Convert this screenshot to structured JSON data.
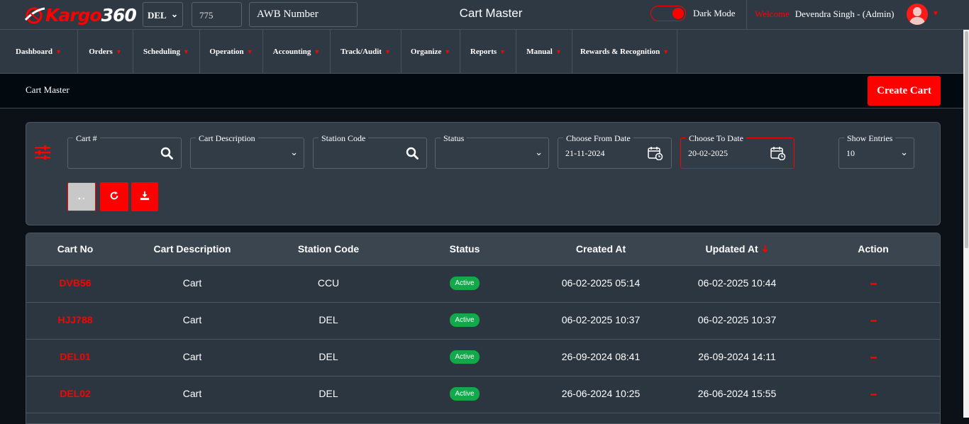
{
  "header": {
    "logo_text_brand": "Kargo",
    "logo_text_num": "360",
    "station": "DEL",
    "code": "775",
    "awb_placeholder": "AWB Number",
    "page_title": "Cart Master",
    "dark_mode_label": "Dark Mode",
    "dark_mode_on": true,
    "welcome": "Welcome",
    "user": "Devendra Singh - (Admin)"
  },
  "nav": {
    "items": [
      {
        "label": "Dashboard"
      },
      {
        "label": "Orders"
      },
      {
        "label": "Scheduling"
      },
      {
        "label": "Operation"
      },
      {
        "label": "Accounting"
      },
      {
        "label": "Track/Audit"
      },
      {
        "label": "Organize"
      },
      {
        "label": "Reports"
      },
      {
        "label": "Manual"
      },
      {
        "label": "Rewards & Recognition"
      }
    ]
  },
  "breadcrumb": "Cart Master",
  "create_button": "Create Cart",
  "filters": {
    "cart_no": {
      "label": "Cart #",
      "value": ""
    },
    "cart_description": {
      "label": "Cart Description",
      "value": ""
    },
    "station_code": {
      "label": "Station Code",
      "value": ""
    },
    "status": {
      "label": "Status",
      "value": ""
    },
    "from_date": {
      "label": "Choose From Date",
      "value": "21-11-2024"
    },
    "to_date": {
      "label": "Choose To Date",
      "value": "20-02-2025"
    },
    "show_entries": {
      "label": "Show Entries",
      "value": "10"
    }
  },
  "table": {
    "columns": [
      "Cart No",
      "Cart Description",
      "Station Code",
      "Status",
      "Created At",
      "Updated At",
      "Action"
    ],
    "rows": [
      {
        "cart_no": "DVB56",
        "description": "Cart",
        "station": "CCU",
        "status": "Active",
        "created": "06-02-2025 05:14",
        "updated": "06-02-2025 10:44",
        "action": "•••"
      },
      {
        "cart_no": "HJJ788",
        "description": "Cart",
        "station": "DEL",
        "status": "Active",
        "created": "06-02-2025 10:37",
        "updated": "06-02-2025 10:37",
        "action": "•••"
      },
      {
        "cart_no": "DEL01",
        "description": "Cart",
        "station": "DEL",
        "status": "Active",
        "created": "26-09-2024 08:41",
        "updated": "26-09-2024 14:11",
        "action": "•••"
      },
      {
        "cart_no": "DEL02",
        "description": "Cart",
        "station": "DEL",
        "status": "Active",
        "created": "26-06-2024 10:25",
        "updated": "26-06-2024 15:55",
        "action": "•••"
      }
    ]
  },
  "colors": {
    "accent": "#ff0000",
    "header_bg": "#2f3944",
    "badge": "#13a84a"
  },
  "icons": [
    "search-icon",
    "calendar-icon",
    "filter-sliders-icon",
    "refresh-icon",
    "download-icon",
    "chevron-down-icon",
    "sort-down-arrow-icon",
    "user-avatar-icon"
  ]
}
